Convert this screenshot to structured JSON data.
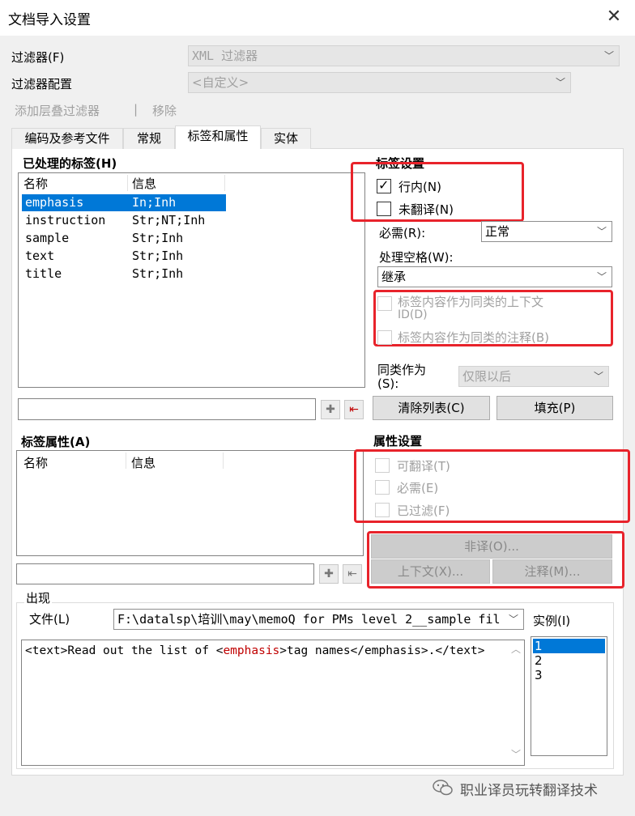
{
  "window": {
    "title": "文档导入设置",
    "close_glyph": "✕"
  },
  "filter": {
    "label": "过滤器(F)",
    "value": "XML 过滤器"
  },
  "filter_config": {
    "label": "过滤器配置",
    "value": "<自定义>"
  },
  "cascade": {
    "add_label": "添加层叠过滤器",
    "separator": "|",
    "remove_label": "移除"
  },
  "tabs": [
    {
      "label": "编码及参考文件"
    },
    {
      "label": "常规"
    },
    {
      "label": "标签和属性"
    },
    {
      "label": "实体"
    }
  ],
  "processed_tags": {
    "header": "已处理的标签(H)",
    "columns": [
      "名称",
      "信息"
    ],
    "rows": [
      {
        "name": "emphasis",
        "info": "In;Inh"
      },
      {
        "name": "instruction",
        "info": "Str;NT;Inh"
      },
      {
        "name": "sample",
        "info": "Str;Inh"
      },
      {
        "name": "text",
        "info": "Str;Inh"
      },
      {
        "name": "title",
        "info": "Str;Inh"
      }
    ],
    "selected_index": 0
  },
  "tag_settings": {
    "header": "标签设置",
    "inline": {
      "label": "行内(N)",
      "checked": true
    },
    "untranslated": {
      "label": "未翻译(N)",
      "checked": false
    },
    "required_label": "必需(R):",
    "required_value": "正常",
    "whitespace_label": "处理空格(W):",
    "whitespace_value": "继承",
    "context_id": {
      "label_line1": "标签内容作为同类的上下文",
      "label_line2": "ID(D)",
      "checked": false
    },
    "comment": {
      "label": "标签内容作为同类的注释(B)",
      "checked": false
    },
    "sibling_label_line1": "同类作为",
    "sibling_label_line2": "(S):",
    "sibling_value": "仅限以后"
  },
  "tag_buttons": {
    "clear_list": "清除列表(C)",
    "fill": "填充(P)"
  },
  "attributes": {
    "header": "标签属性(A)",
    "columns": [
      "名称",
      "信息"
    ]
  },
  "attr_settings": {
    "header": "属性设置",
    "translatable": "可翻译(T)",
    "required": "必需(E)",
    "filtered": "已过滤(F)",
    "nontrans_button": "非译(O)...",
    "context_button": "上下文(X)...",
    "comment_button": "注释(M)..."
  },
  "occurrence": {
    "header": "出现",
    "file_label": "文件(L)",
    "file_value": "F:\\datalsp\\培训\\may\\memoQ for PMs level 2__sample fil",
    "instance_label": "实例(I)",
    "instances": [
      "1",
      "2",
      "3"
    ],
    "preview_parts": [
      "<text>Read out the list of <",
      "emphasis",
      ">tag names</emphasis>.</text>"
    ]
  },
  "watermark": "职业译员玩转翻译技术",
  "icons": {
    "plus": "✚",
    "edit": "⇤",
    "chevron": "﹀",
    "check": "✓",
    "scroll_up": "︿",
    "scroll_down": "﹀"
  },
  "colors": {
    "selection": "#0078d7",
    "highlight_box": "#e8232b",
    "tag_red": "#c00000"
  }
}
